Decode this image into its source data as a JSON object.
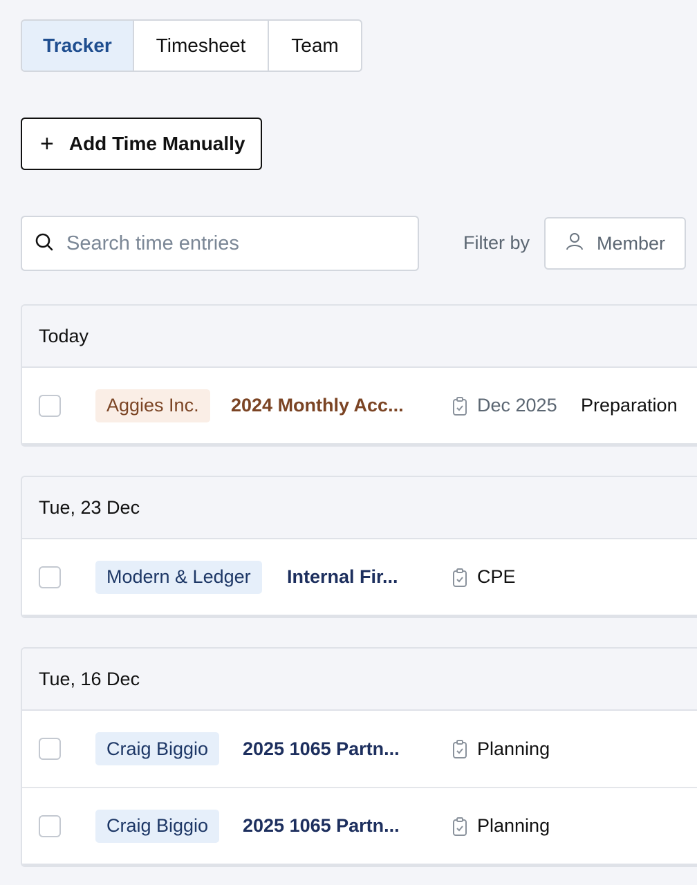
{
  "tabs": [
    {
      "label": "Tracker",
      "active": true
    },
    {
      "label": "Timesheet",
      "active": false
    },
    {
      "label": "Team",
      "active": false
    }
  ],
  "add_time_label": "Add Time Manually",
  "search": {
    "placeholder": "Search time entries"
  },
  "filter": {
    "label": "Filter by",
    "member_label": "Member"
  },
  "groups": [
    {
      "title": "Today",
      "entries": [
        {
          "client": "Aggies Inc.",
          "project": "2024 Monthly Acc...",
          "period": "Dec 2025",
          "task": "Preparation"
        }
      ]
    },
    {
      "title": "Tue, 23 Dec",
      "entries": [
        {
          "client": "Modern & Ledger",
          "project": "Internal Fir...",
          "task": "CPE"
        }
      ]
    },
    {
      "title": "Tue, 16 Dec",
      "entries": [
        {
          "client": "Craig Biggio",
          "project": "2025 1065 Partn...",
          "task": "Planning"
        },
        {
          "client": "Craig Biggio",
          "project": "2025 1065 Partn...",
          "task": "Planning"
        }
      ]
    }
  ],
  "colors": {
    "accent": "#1f4e8f",
    "active_tab_bg": "#e6effa",
    "warm_tag_bg": "#faeee6",
    "warm_text": "#7b4424",
    "cool_text": "#1d2f5e"
  },
  "icons": [
    "plus-icon",
    "search-icon",
    "user-icon",
    "clipboard-icon"
  ]
}
